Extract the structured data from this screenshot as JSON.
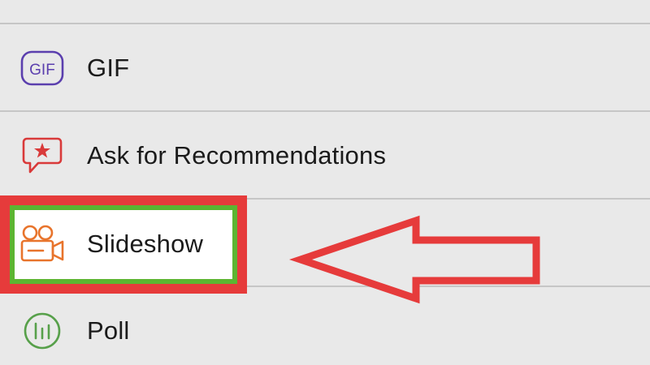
{
  "menu": {
    "items": [
      {
        "label": "GIF",
        "icon": "gif-icon",
        "color": "#5b3fae"
      },
      {
        "label": "Ask for Recommendations",
        "icon": "recommendation-speech-bubble-icon",
        "color": "#d93a3a"
      },
      {
        "label": "Slideshow",
        "icon": "video-camera-icon",
        "color": "#e8742c",
        "highlighted": true
      },
      {
        "label": "Poll",
        "icon": "poll-chart-icon",
        "color": "#57a04a"
      }
    ]
  },
  "icons": {
    "gif_text": "GIF"
  },
  "annotation": {
    "arrow_color": "#e63b3b",
    "highlight_outer_color": "#e63b3b",
    "highlight_inner_color": "#5cb531"
  }
}
